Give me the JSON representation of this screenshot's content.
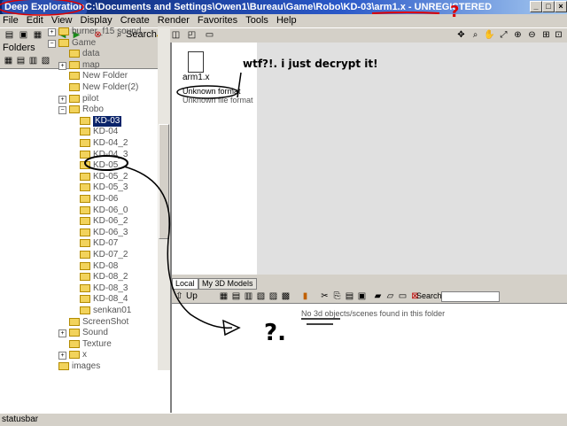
{
  "window": {
    "app_name": "Deep Exploration",
    "title_separator": " - ",
    "path": "C:\\Documents and Settings\\Owen1\\Bureau\\Game\\Robo\\KD-03\\arm1.x",
    "unregistered": " - UNREGISTERED",
    "buttons": {
      "minimize": "_",
      "maximize": "□",
      "close": "×"
    }
  },
  "menu": [
    "File",
    "Edit",
    "View",
    "Display",
    "Create",
    "Render",
    "Favorites",
    "Tools",
    "Help"
  ],
  "toolbar": {
    "search_label": "Search"
  },
  "folders_panel": {
    "title": "Folders",
    "close": "x",
    "tree": [
      {
        "label": "burner_f15 sound",
        "indent": 0,
        "expander": "+"
      },
      {
        "label": "Game",
        "indent": 0,
        "expander": "−"
      },
      {
        "label": "data",
        "indent": 1,
        "expander": ""
      },
      {
        "label": "map",
        "indent": 1,
        "expander": "+"
      },
      {
        "label": "New Folder",
        "indent": 1,
        "expander": ""
      },
      {
        "label": "New Folder(2)",
        "indent": 1,
        "expander": ""
      },
      {
        "label": "pilot",
        "indent": 1,
        "expander": "+"
      },
      {
        "label": "Robo",
        "indent": 1,
        "expander": "−"
      },
      {
        "label": "KD-03",
        "indent": 2,
        "expander": "",
        "selected": true
      },
      {
        "label": "KD-04",
        "indent": 2,
        "expander": ""
      },
      {
        "label": "KD-04_2",
        "indent": 2,
        "expander": ""
      },
      {
        "label": "KD-04_3",
        "indent": 2,
        "expander": ""
      },
      {
        "label": "KD-05",
        "indent": 2,
        "expander": ""
      },
      {
        "label": "KD-05_2",
        "indent": 2,
        "expander": ""
      },
      {
        "label": "KD-05_3",
        "indent": 2,
        "expander": ""
      },
      {
        "label": "KD-06",
        "indent": 2,
        "expander": ""
      },
      {
        "label": "KD-06_0",
        "indent": 2,
        "expander": ""
      },
      {
        "label": "KD-06_2",
        "indent": 2,
        "expander": ""
      },
      {
        "label": "KD-06_3",
        "indent": 2,
        "expander": ""
      },
      {
        "label": "KD-07",
        "indent": 2,
        "expander": ""
      },
      {
        "label": "KD-07_2",
        "indent": 2,
        "expander": ""
      },
      {
        "label": "KD-08",
        "indent": 2,
        "expander": ""
      },
      {
        "label": "KD-08_2",
        "indent": 2,
        "expander": ""
      },
      {
        "label": "KD-08_3",
        "indent": 2,
        "expander": ""
      },
      {
        "label": "KD-08_4",
        "indent": 2,
        "expander": ""
      },
      {
        "label": "senkan01",
        "indent": 2,
        "expander": ""
      },
      {
        "label": "ScreenShot",
        "indent": 1,
        "expander": ""
      },
      {
        "label": "Sound",
        "indent": 1,
        "expander": "+"
      },
      {
        "label": "Texture",
        "indent": 1,
        "expander": ""
      },
      {
        "label": "x",
        "indent": 1,
        "expander": "+"
      },
      {
        "label": "images",
        "indent": 0,
        "expander": ""
      }
    ]
  },
  "file_view": {
    "file_name": "arm1.x",
    "format_badge": "Unknown format",
    "format_sub": "Unknown file format"
  },
  "bottom_panel": {
    "tabs": [
      "Local",
      "My 3D Models"
    ],
    "up_label": "Up",
    "search_label": "Search:",
    "empty_message": "No 3d objects/scenes found in this folder"
  },
  "statusbar": {
    "text": "statusbar"
  },
  "annotations": {
    "wtf": "wtf?!. i just decrypt it!",
    "question_mark": "?",
    "question_bottom": "?."
  },
  "colors": {
    "annotation_red": "#e00000",
    "annotation_black": "#000000",
    "folder": "#f2d35c"
  }
}
